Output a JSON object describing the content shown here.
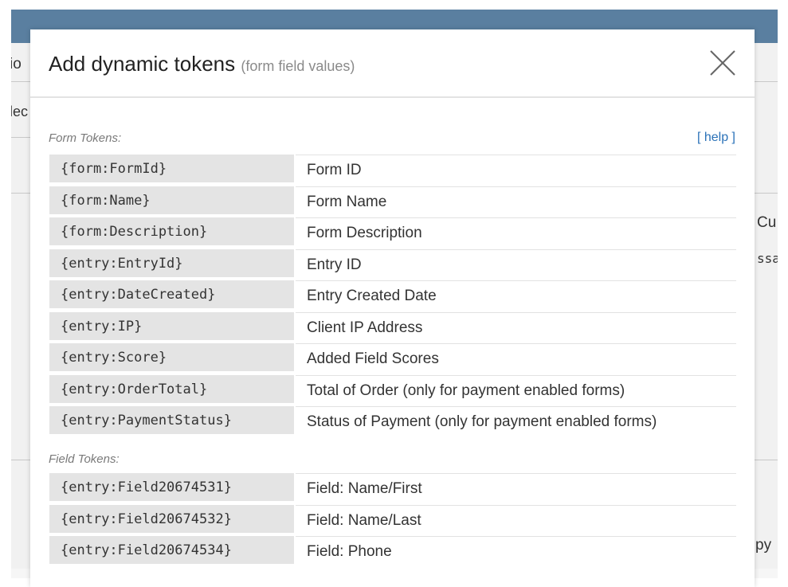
{
  "background": {
    "left_fragments": [
      "io",
      "lec"
    ],
    "right_fragments": [
      "Cu",
      "ssa",
      "py"
    ]
  },
  "modal": {
    "title": "Add dynamic tokens",
    "subtitle": "(form field values)",
    "close_icon": "close-icon",
    "help_label": "[ help ]",
    "sections": [
      {
        "label": "Form Tokens:",
        "rows": [
          {
            "token": "{form:FormId}",
            "description": "Form ID"
          },
          {
            "token": "{form:Name}",
            "description": "Form Name"
          },
          {
            "token": "{form:Description}",
            "description": "Form Description"
          },
          {
            "token": "{entry:EntryId}",
            "description": "Entry ID"
          },
          {
            "token": "{entry:DateCreated}",
            "description": "Entry Created Date"
          },
          {
            "token": "{entry:IP}",
            "description": "Client IP Address"
          },
          {
            "token": "{entry:Score}",
            "description": "Added Field Scores"
          },
          {
            "token": "{entry:OrderTotal}",
            "description": "Total of Order (only for payment enabled forms)"
          },
          {
            "token": "{entry:PaymentStatus}",
            "description": "Status of Payment (only for payment enabled forms)"
          }
        ]
      },
      {
        "label": "Field Tokens:",
        "rows": [
          {
            "token": "{entry:Field20674531}",
            "description": "Field: Name/First"
          },
          {
            "token": "{entry:Field20674532}",
            "description": "Field: Name/Last"
          },
          {
            "token": "{entry:Field20674534}",
            "description": "Field: Phone"
          }
        ]
      }
    ]
  },
  "colors": {
    "topbar": "#5a7fa0",
    "token_background": "#e4e4e4",
    "link": "#2b72b8"
  }
}
